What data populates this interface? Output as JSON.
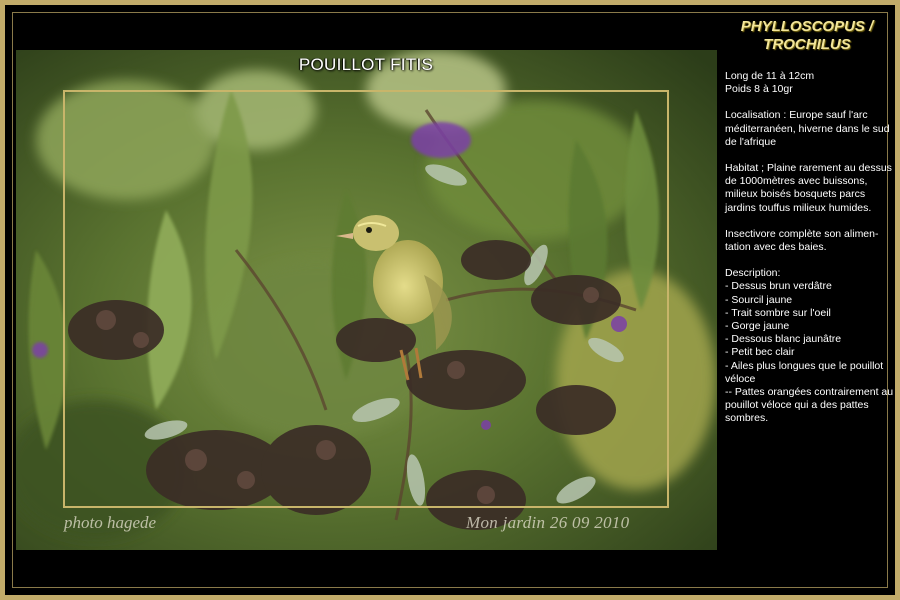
{
  "photo": {
    "title": "POUILLOT FITIS",
    "credit_left": "photo hagede",
    "credit_right": "Mon jardin 26 09 2010"
  },
  "sidebar": {
    "species_line1": "PHYLLOSCOPUS /",
    "species_line2": "TROCHILUS",
    "size_line1": "Long de 11 à 12cm",
    "size_line2": "Poids 8 à 10gr",
    "localisation": "Localisation : Europe sauf l'arc méditerranéen, hiverne dans le sud de l'afrique",
    "habitat": "Habitat ; Plaine rarement au dessus de 1000mètres  avec buissons, milieux boisés bosquets parcs  jardins touffus milieux humides.",
    "diet": "Insectivore complète son alimen-tation avec des baies.",
    "description_heading": "Description:",
    "description_items": [
      "- Dessus brun verdâtre",
      "- Sourcil jaune",
      "- Trait sombre sur l'oeil",
      "- Gorge jaune",
      "- Dessous blanc jaunâtre",
      "- Petit bec clair",
      "- Ailes plus longues que le pouillot véloce",
      "-- Pattes orangées contrairement au pouillot véloce qui a des pattes sombres."
    ]
  },
  "colors": {
    "frame_gold": "#c2ab6a",
    "species_yellow": "#f3e69a",
    "foliage_green": "#5d7a3a",
    "bird_yellow": "#d9d27a",
    "flower_purple": "#7b3fa8"
  }
}
